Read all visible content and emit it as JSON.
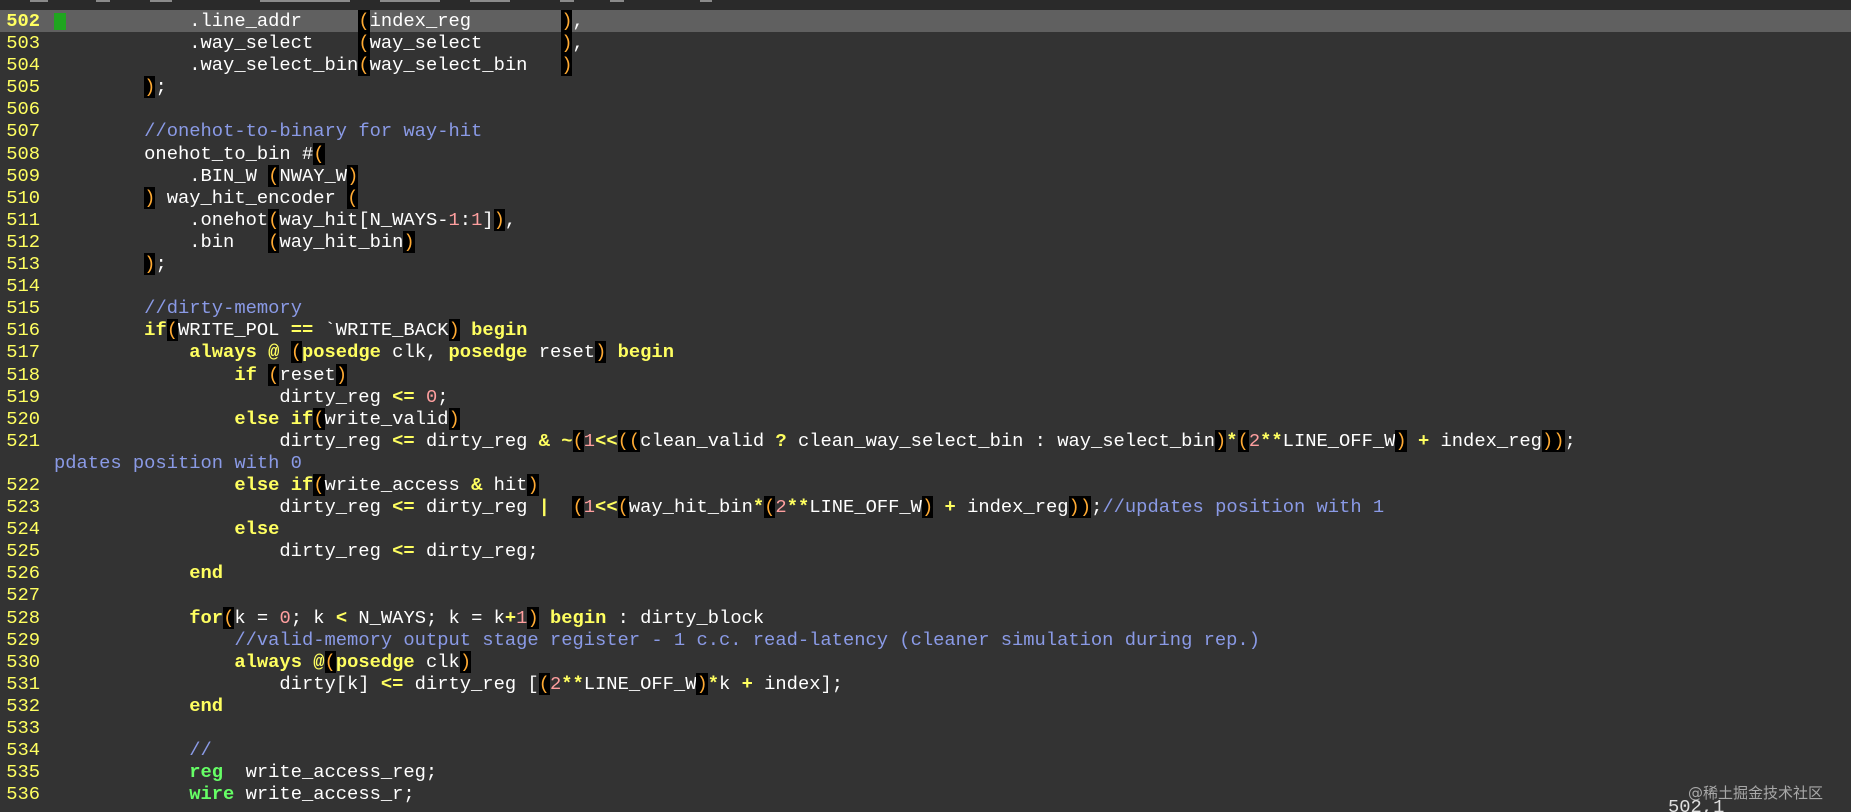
{
  "editor": {
    "current_line": "502",
    "status_position": "502,1",
    "watermark": "@稀土掘金技术社区"
  },
  "colors": {
    "background": "#333333",
    "current_line_bg": "#606060",
    "line_number": "#ffff60",
    "comment": "#8a9ae6",
    "keyword": "#ffff60",
    "number": "#ff9f9f",
    "paren_match": "#ffaa33",
    "type_keyword": "#66ff66",
    "sign_marker": "#1fa51f"
  },
  "lines": [
    {
      "num": "502",
      "current": true,
      "text": "            .line_addr     (index_reg        ),"
    },
    {
      "num": "503",
      "text": "            .way_select    (way_select       ),"
    },
    {
      "num": "504",
      "text": "            .way_select_bin(way_select_bin   )"
    },
    {
      "num": "505",
      "text": "        );"
    },
    {
      "num": "506",
      "text": ""
    },
    {
      "num": "507",
      "text": "        //onehot-to-binary for way-hit"
    },
    {
      "num": "508",
      "text": "        onehot_to_bin #("
    },
    {
      "num": "509",
      "text": "            .BIN_W (NWAY_W)"
    },
    {
      "num": "510",
      "text": "        ) way_hit_encoder ("
    },
    {
      "num": "511",
      "text": "            .onehot(way_hit[N_WAYS-1:1]),"
    },
    {
      "num": "512",
      "text": "            .bin   (way_hit_bin)"
    },
    {
      "num": "513",
      "text": "        );"
    },
    {
      "num": "514",
      "text": ""
    },
    {
      "num": "515",
      "text": "        //dirty-memory"
    },
    {
      "num": "516",
      "text": "        if(WRITE_POL == `WRITE_BACK) begin"
    },
    {
      "num": "517",
      "text": "            always @ (posedge clk, posedge reset) begin"
    },
    {
      "num": "518",
      "text": "                if (reset)"
    },
    {
      "num": "519",
      "text": "                    dirty_reg <= 0;"
    },
    {
      "num": "520",
      "text": "                else if(write_valid)"
    },
    {
      "num": "521",
      "text": "                    dirty_reg <= dirty_reg & ~(1<<((clean_valid ? clean_way_select_bin : way_select_bin)*(2**LINE_OFF_W) + index_reg));"
    },
    {
      "num": "",
      "wrap": true,
      "text": "pdates position with 0"
    },
    {
      "num": "522",
      "text": "                else if(write_access & hit)"
    },
    {
      "num": "523",
      "text": "                    dirty_reg <= dirty_reg |  (1<<(way_hit_bin*(2**LINE_OFF_W) + index_reg));//updates position with 1"
    },
    {
      "num": "524",
      "text": "                else"
    },
    {
      "num": "525",
      "text": "                    dirty_reg <= dirty_reg;"
    },
    {
      "num": "526",
      "text": "            end"
    },
    {
      "num": "527",
      "text": ""
    },
    {
      "num": "528",
      "text": "            for(k = 0; k < N_WAYS; k = k+1) begin : dirty_block"
    },
    {
      "num": "529",
      "text": "                //valid-memory output stage register - 1 c.c. read-latency (cleaner simulation during rep.)"
    },
    {
      "num": "530",
      "text": "                always @(posedge clk)"
    },
    {
      "num": "531",
      "text": "                    dirty[k] <= dirty_reg [(2**LINE_OFF_W)*k + index];"
    },
    {
      "num": "532",
      "text": "            end"
    },
    {
      "num": "533",
      "text": ""
    },
    {
      "num": "534",
      "text": "            //"
    },
    {
      "num": "535",
      "text": "            reg  write_access_reg;"
    },
    {
      "num": "536",
      "text": "            wire write_access_r;"
    }
  ]
}
